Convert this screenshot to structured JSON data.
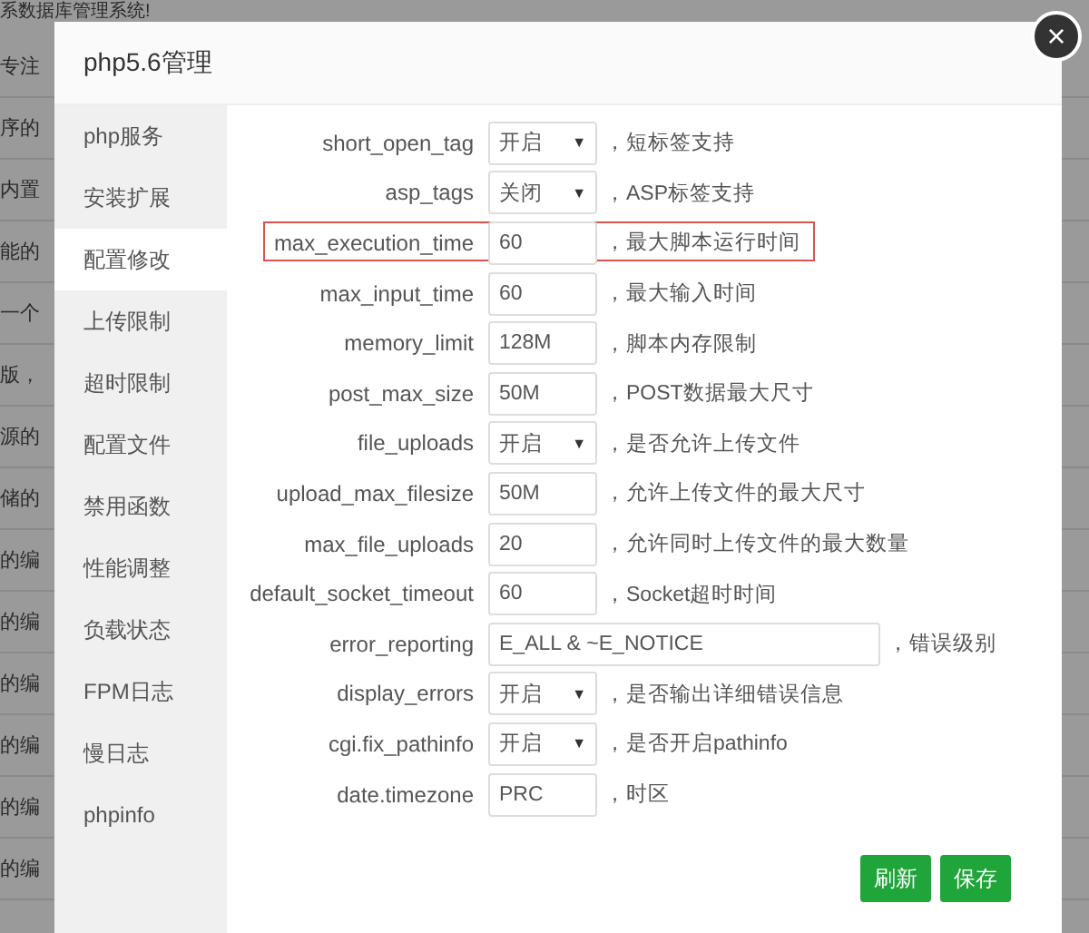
{
  "background_title": "系数据库管理系统!",
  "background_rows": [
    "专注",
    "序的",
    "内置",
    "能的",
    "一个",
    "版，",
    "源的",
    "储的",
    "的编",
    "的编",
    "的编",
    "的编",
    "的编",
    "的编"
  ],
  "dialog": {
    "title": "php5.6管理",
    "close": "×"
  },
  "sidebar": [
    {
      "label": "php服务",
      "selected": false
    },
    {
      "label": "安装扩展",
      "selected": false
    },
    {
      "label": "配置修改",
      "selected": true
    },
    {
      "label": "上传限制",
      "selected": false
    },
    {
      "label": "超时限制",
      "selected": false
    },
    {
      "label": "配置文件",
      "selected": false
    },
    {
      "label": "禁用函数",
      "selected": false
    },
    {
      "label": "性能调整",
      "selected": false
    },
    {
      "label": "负载状态",
      "selected": false
    },
    {
      "label": "FPM日志",
      "selected": false
    },
    {
      "label": "慢日志",
      "selected": false
    },
    {
      "label": "phpinfo",
      "selected": false
    }
  ],
  "settings": [
    {
      "name": "short_open_tag",
      "kind": "select",
      "value": "开启",
      "note": "，短标签支持",
      "highlighted": false
    },
    {
      "name": "asp_tags",
      "kind": "select",
      "value": "关闭",
      "note": "，ASP标签支持",
      "highlighted": false
    },
    {
      "name": "max_execution_time",
      "kind": "input",
      "value": "60",
      "note": "，最大脚本运行时间",
      "highlighted": true
    },
    {
      "name": "max_input_time",
      "kind": "input",
      "value": "60",
      "note": "，最大输入时间",
      "highlighted": false
    },
    {
      "name": "memory_limit",
      "kind": "input",
      "value": "128M",
      "note": "，脚本内存限制",
      "highlighted": false
    },
    {
      "name": "post_max_size",
      "kind": "input",
      "value": "50M",
      "note": "，POST数据最大尺寸",
      "highlighted": false
    },
    {
      "name": "file_uploads",
      "kind": "select",
      "value": "开启",
      "note": "，是否允许上传文件",
      "highlighted": false
    },
    {
      "name": "upload_max_filesize",
      "kind": "input",
      "value": "50M",
      "note": "，允许上传文件的最大尺寸",
      "highlighted": false
    },
    {
      "name": "max_file_uploads",
      "kind": "input",
      "value": "20",
      "note": "，允许同时上传文件的最大数量",
      "highlighted": false
    },
    {
      "name": "default_socket_timeout",
      "kind": "input",
      "value": "60",
      "note": "，Socket超时时间",
      "highlighted": false
    },
    {
      "name": "error_reporting",
      "kind": "wide",
      "value": "E_ALL & ~E_NOTICE",
      "note": "，错误级别",
      "highlighted": false
    },
    {
      "name": "display_errors",
      "kind": "select",
      "value": "开启",
      "note": "，是否输出详细错误信息",
      "highlighted": false
    },
    {
      "name": "cgi.fix_pathinfo",
      "kind": "select",
      "value": "开启",
      "note": "，是否开启pathinfo",
      "highlighted": false
    },
    {
      "name": "date.timezone",
      "kind": "input",
      "value": "PRC",
      "note": "，时区",
      "highlighted": false
    }
  ],
  "buttons": [
    "刷新",
    "保存"
  ],
  "select_arrow": "▼"
}
